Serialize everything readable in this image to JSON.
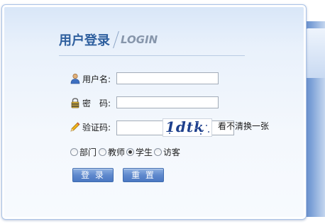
{
  "login": {
    "title_cn": "用户登录",
    "title_en": "LOGIN",
    "username": {
      "label": "用户名:",
      "value": "",
      "icon": "user-icon"
    },
    "password": {
      "label": "密　码:",
      "value": "",
      "icon": "lock-icon"
    },
    "captcha": {
      "label": "验证码:",
      "value": "",
      "icon": "pencil-icon",
      "image_text": "1dtk",
      "refresh_link": "看不清换一张"
    },
    "roles": [
      {
        "label": "部门",
        "checked": false
      },
      {
        "label": "教师",
        "checked": false
      },
      {
        "label": "学生",
        "checked": true
      },
      {
        "label": "访客",
        "checked": false
      }
    ],
    "buttons": {
      "login": "登 录",
      "reset": "重 置"
    }
  },
  "colors": {
    "title": "#2e5f9e",
    "button": "#5f89cd",
    "panel_accent": "#7a9fd6"
  }
}
